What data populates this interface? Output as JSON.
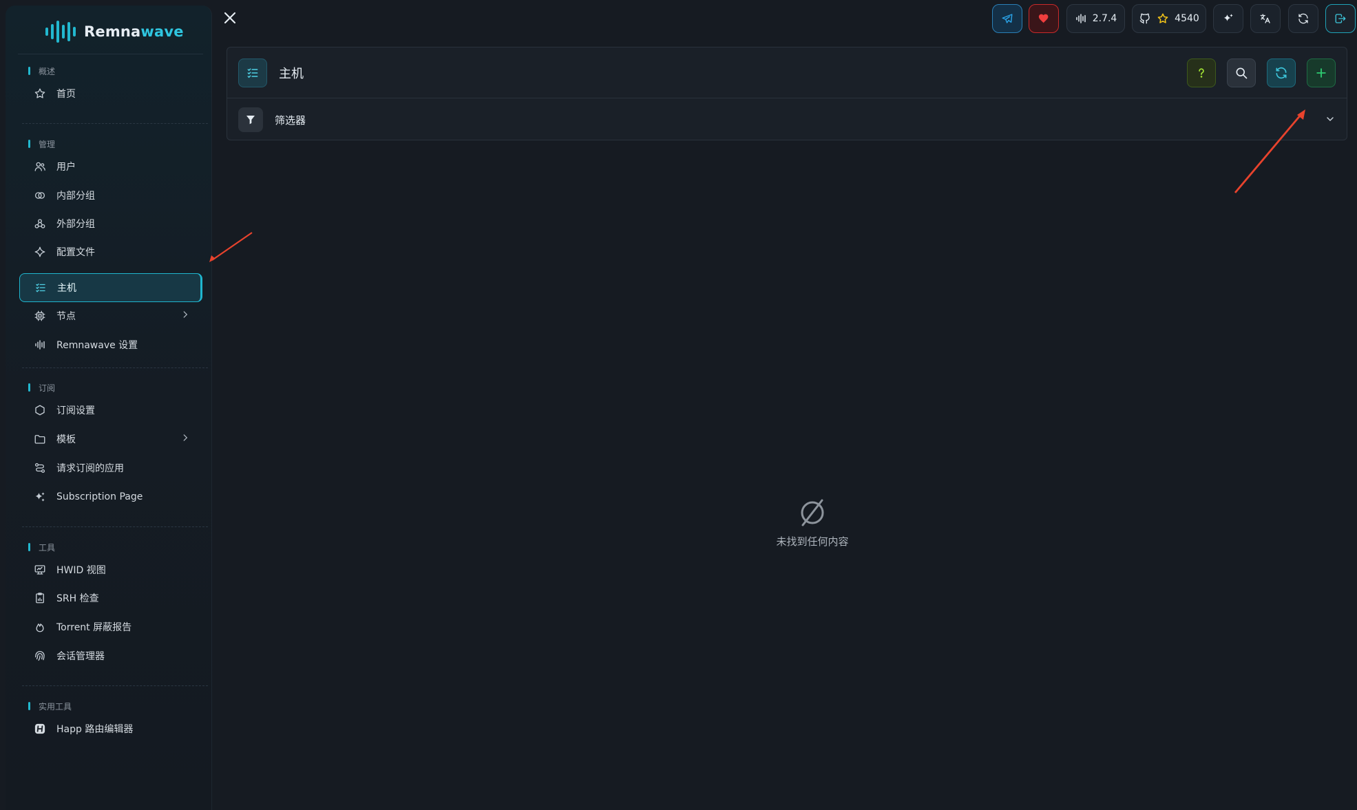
{
  "brand": {
    "name_main": "Remna",
    "name_accent": "wave"
  },
  "sidebar": {
    "sections": {
      "overview": "概述",
      "management": "管理",
      "subscription": "订阅",
      "tools": "工具",
      "utilities": "实用工具"
    },
    "items": {
      "home": "首页",
      "users": "用户",
      "internal_squads": "内部分组",
      "external_squads": "外部分组",
      "config_profiles": "配置文件",
      "hosts": "主机",
      "nodes": "节点",
      "remnawave_settings": "Remnawave 设置",
      "subscription_settings": "订阅设置",
      "templates": "模板",
      "request_apps": "请求订阅的应用",
      "subscription_page": "Subscription Page",
      "hwid": "HWID 视图",
      "srh": "SRH 检查",
      "torrent": "Torrent 屏蔽报告",
      "sessions": "会话管理器",
      "happ": "Happ 路由编辑器"
    },
    "active_item": "hosts"
  },
  "topbar": {
    "version": "2.7.4",
    "github_stars": "4540",
    "buttons": [
      "telegram-icon",
      "heart-icon",
      "version-badge",
      "github-stars",
      "sparkles-icon",
      "translate-icon",
      "refresh-icon",
      "logout-icon"
    ]
  },
  "main": {
    "title": "主机",
    "filter_label": "筛选器",
    "actions": [
      "help-icon",
      "search-icon",
      "refresh-icon",
      "plus-icon"
    ],
    "empty_text": "未找到任何内容"
  },
  "colors": {
    "accent": "#22b8cf",
    "help": "#a3e635",
    "add": "#2ecc71",
    "annotation": "#e8432d",
    "heart": "#e03131",
    "telegram": "#2aa3e8"
  }
}
